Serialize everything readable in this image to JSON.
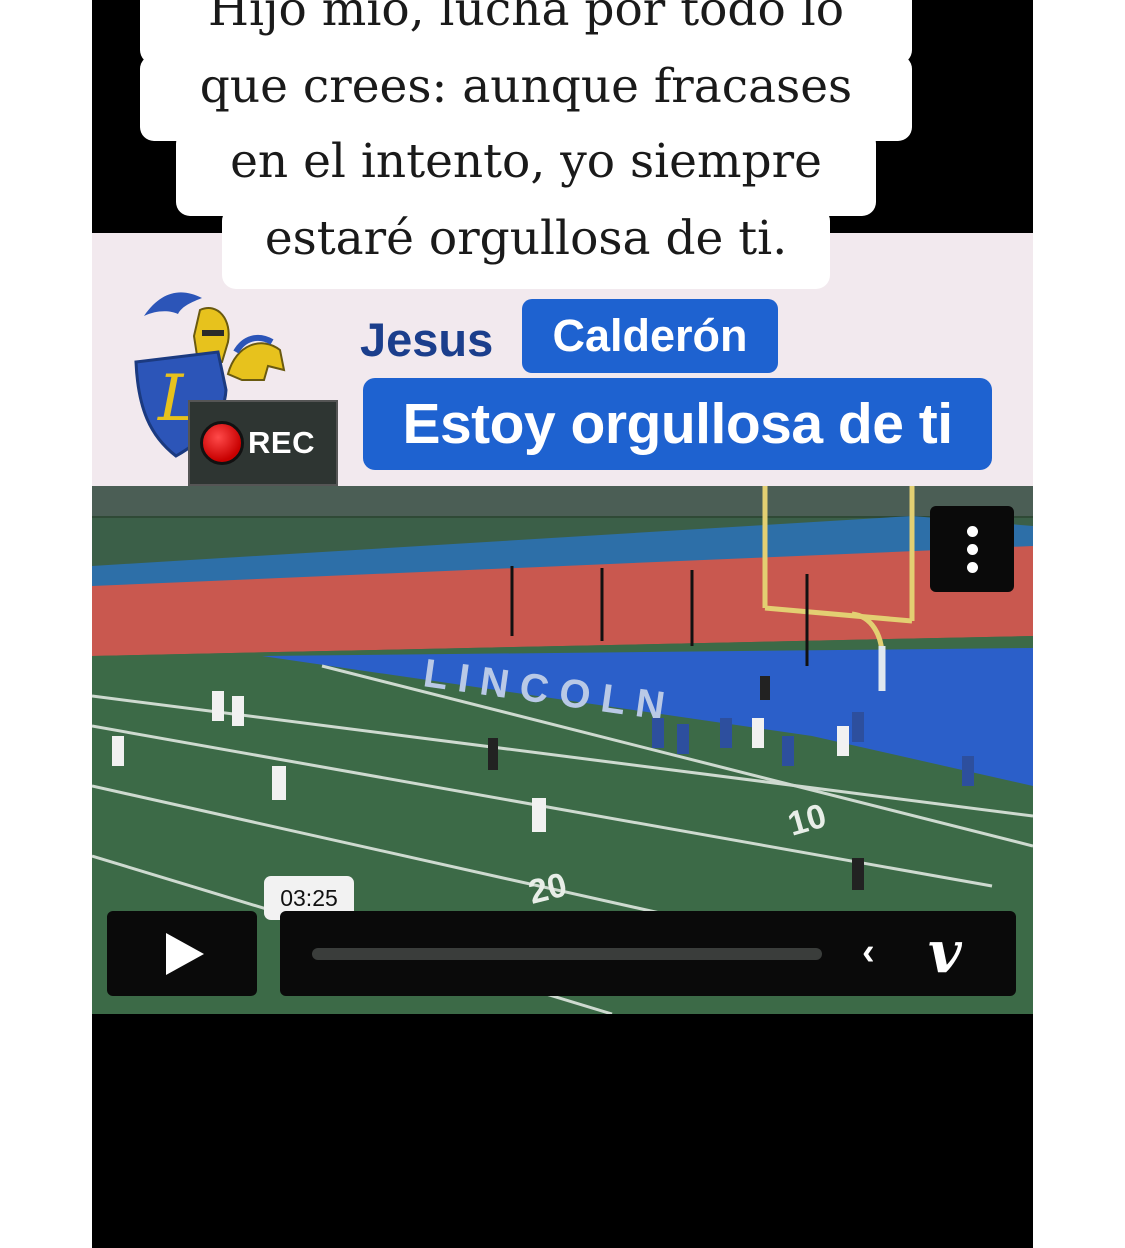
{
  "quote": {
    "lines": [
      "Hijo mío, lucha por todo lo",
      "que crees: aunque fracases",
      "en el intento, yo siempre",
      "estaré orgullosa de ti."
    ]
  },
  "overlay": {
    "rec_label": "REC",
    "name_first": "Jesus",
    "name_last": "Calderón",
    "caption": "Estoy orgullosa de ti"
  },
  "player": {
    "timestamp": "03:25",
    "progress": 0.0,
    "brand_mark": "v",
    "icons": [
      "play-icon",
      "more-vertical-icon",
      "chevron-left-icon",
      "vimeo-logo-icon"
    ]
  },
  "colors": {
    "accent_blue": "#1e62d0",
    "name_blue": "#1b3e8c",
    "band_pink": "#f2e9ee",
    "field_green": "#3c6a47",
    "end_zone_blue": "#2b5fc9",
    "track_red": "#c9584f",
    "logo_gold": "#e7c21d"
  }
}
